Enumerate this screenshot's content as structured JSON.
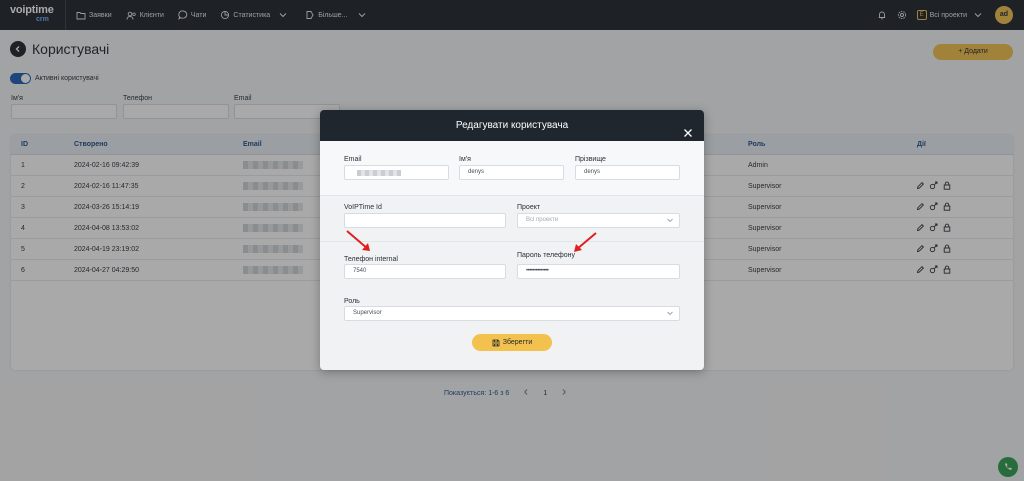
{
  "app": {
    "logo_main": "voiptime",
    "logo_sub": "crm"
  },
  "nav": {
    "items": [
      {
        "label": "Заявки",
        "icon": "folder-icon"
      },
      {
        "label": "Клієнти",
        "icon": "users-icon"
      },
      {
        "label": "Чати",
        "icon": "chat-icon"
      },
      {
        "label": "Статистика",
        "icon": "chart-icon"
      },
      {
        "label": "Більше...",
        "icon": "more-icon"
      }
    ],
    "project_selector": "Всі проекти",
    "avatar_initials": "ad"
  },
  "page": {
    "title": "Користувачі",
    "add_button": "+ Додати",
    "toggle_label": "Активні користувачі"
  },
  "filters": {
    "name_label": "Ім'я",
    "phone_label": "Телефон",
    "email_label": "Email"
  },
  "table": {
    "columns": {
      "id": "ID",
      "created": "Створено",
      "email": "Email",
      "role": "Роль",
      "actions": "Дії"
    },
    "rows": [
      {
        "id": "1",
        "created": "2024-02-16 09:42:39",
        "role": "Admin",
        "has_actions": false
      },
      {
        "id": "2",
        "created": "2024-02-16 11:47:35",
        "role": "Supervisor",
        "has_actions": true
      },
      {
        "id": "3",
        "created": "2024-03-26 15:14:19",
        "role": "Supervisor",
        "has_actions": true
      },
      {
        "id": "4",
        "created": "2024-04-08 13:53:02",
        "role": "Supervisor",
        "has_actions": true
      },
      {
        "id": "5",
        "created": "2024-04-19 23:19:02",
        "role": "Supervisor",
        "has_actions": true
      },
      {
        "id": "6",
        "created": "2024-04-27 04:29:50",
        "role": "Supervisor",
        "has_actions": true
      }
    ]
  },
  "pagination": {
    "summary": "Показується: 1-6 з 6",
    "page": "1"
  },
  "modal": {
    "title": "Редагувати користувача",
    "email_label": "Email",
    "name_label": "Ім'я",
    "name_value": "denys",
    "surname_label": "Прізвище",
    "surname_value": "denys",
    "voiptime_id_label": "VoIPTime Id",
    "voiptime_id_value": "",
    "project_label": "Проект",
    "project_placeholder": "Всі проекти",
    "phone_internal_label": "Телефон internal",
    "phone_internal_value": "7540",
    "phone_password_label": "Пароль телефону",
    "phone_password_value": "••••••••••••••",
    "role_label": "Роль",
    "role_value": "Supervisor",
    "save_button": "Зберегти"
  },
  "colors": {
    "dark": "#1f262e",
    "accent": "#f2c14e",
    "link": "#1f4e86",
    "toggle": "#1f5fb8",
    "arrow": "#e02020"
  }
}
